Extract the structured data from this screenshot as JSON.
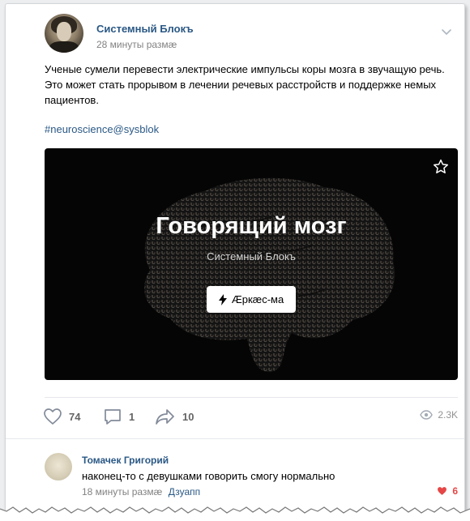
{
  "post": {
    "author": "Системный Блокъ",
    "time": "28 минуты размæ",
    "text": "Ученые сумели перевести электрические импульсы коры мозга в звучащую речь. Это может стать прорывом в лечении речевых расстройств и поддержке немых пациентов.",
    "hashtag": "#neuroscience@sysblok"
  },
  "snippet": {
    "title": "Говорящий мозг",
    "subtitle": "Системный Блокъ",
    "button_label": "Æркæс-ма",
    "bg_color": "#050505"
  },
  "actions": {
    "likes": "74",
    "comments": "1",
    "shares": "10",
    "views": "2.3K"
  },
  "comment": {
    "author": "Томачек Григорий",
    "text": "наконец-то с девушками говорить смогу нормально",
    "time": "18 минуты размæ",
    "reply_label": "Дзуапп",
    "likes": "6",
    "like_color": "#e64646"
  },
  "colors": {
    "link": "#2a5885",
    "muted": "#828282"
  }
}
